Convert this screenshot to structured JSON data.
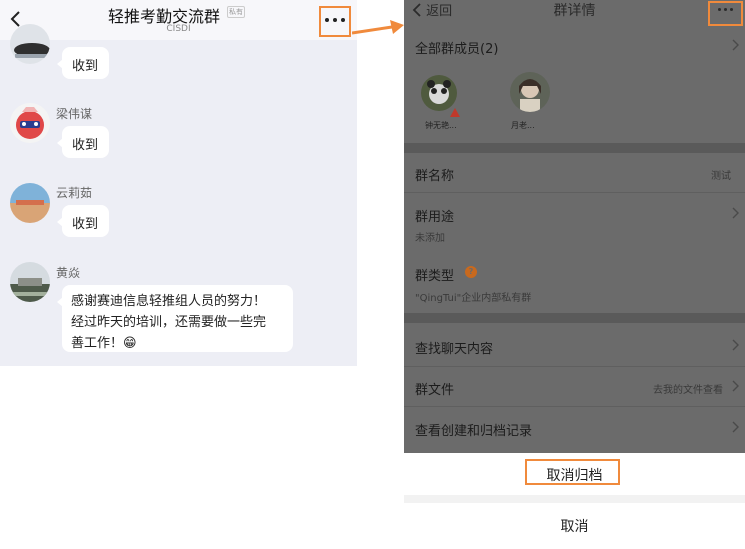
{
  "chat": {
    "title": "轻推考勤交流群",
    "private_tag": "私有",
    "subtitle": "CISDI",
    "back_icon": "chevron-left-icon",
    "more_icon": "more-dots-icon",
    "messages": [
      {
        "sender": "",
        "text": "收到"
      },
      {
        "sender": "梁伟谋",
        "text": "收到"
      },
      {
        "sender": "云莉茹",
        "text": "收到"
      },
      {
        "sender": "黄焱",
        "text_line1": "感谢赛迪信息轻推组人员的努力！",
        "text_line2": "经过昨天的培训，还需要做一些完",
        "text_line3": "善工作！😁"
      }
    ]
  },
  "details": {
    "back": "返回",
    "title": "群详情",
    "all_members": "全部群成员(2)",
    "members": [
      {
        "name": "钟无艳..."
      },
      {
        "name": "月老..."
      }
    ],
    "group_name_label": "群名称",
    "group_name_value": "测试",
    "group_use_label": "群用途",
    "group_use_value": "未添加",
    "group_type_label": "群类型",
    "group_type_value": "\"QingTui\"企业内部私有群",
    "find_chat": "查找聊天内容",
    "group_files": "群文件",
    "group_files_value": "去我的文件查看",
    "view_records": "查看创建和归档记录"
  },
  "sheet": {
    "unarchive": "取消归档",
    "cancel": "取消"
  },
  "colors": {
    "highlight": "#f08a3c",
    "chat_bg": "#edeef5",
    "overlay": "#6b6b6b"
  }
}
